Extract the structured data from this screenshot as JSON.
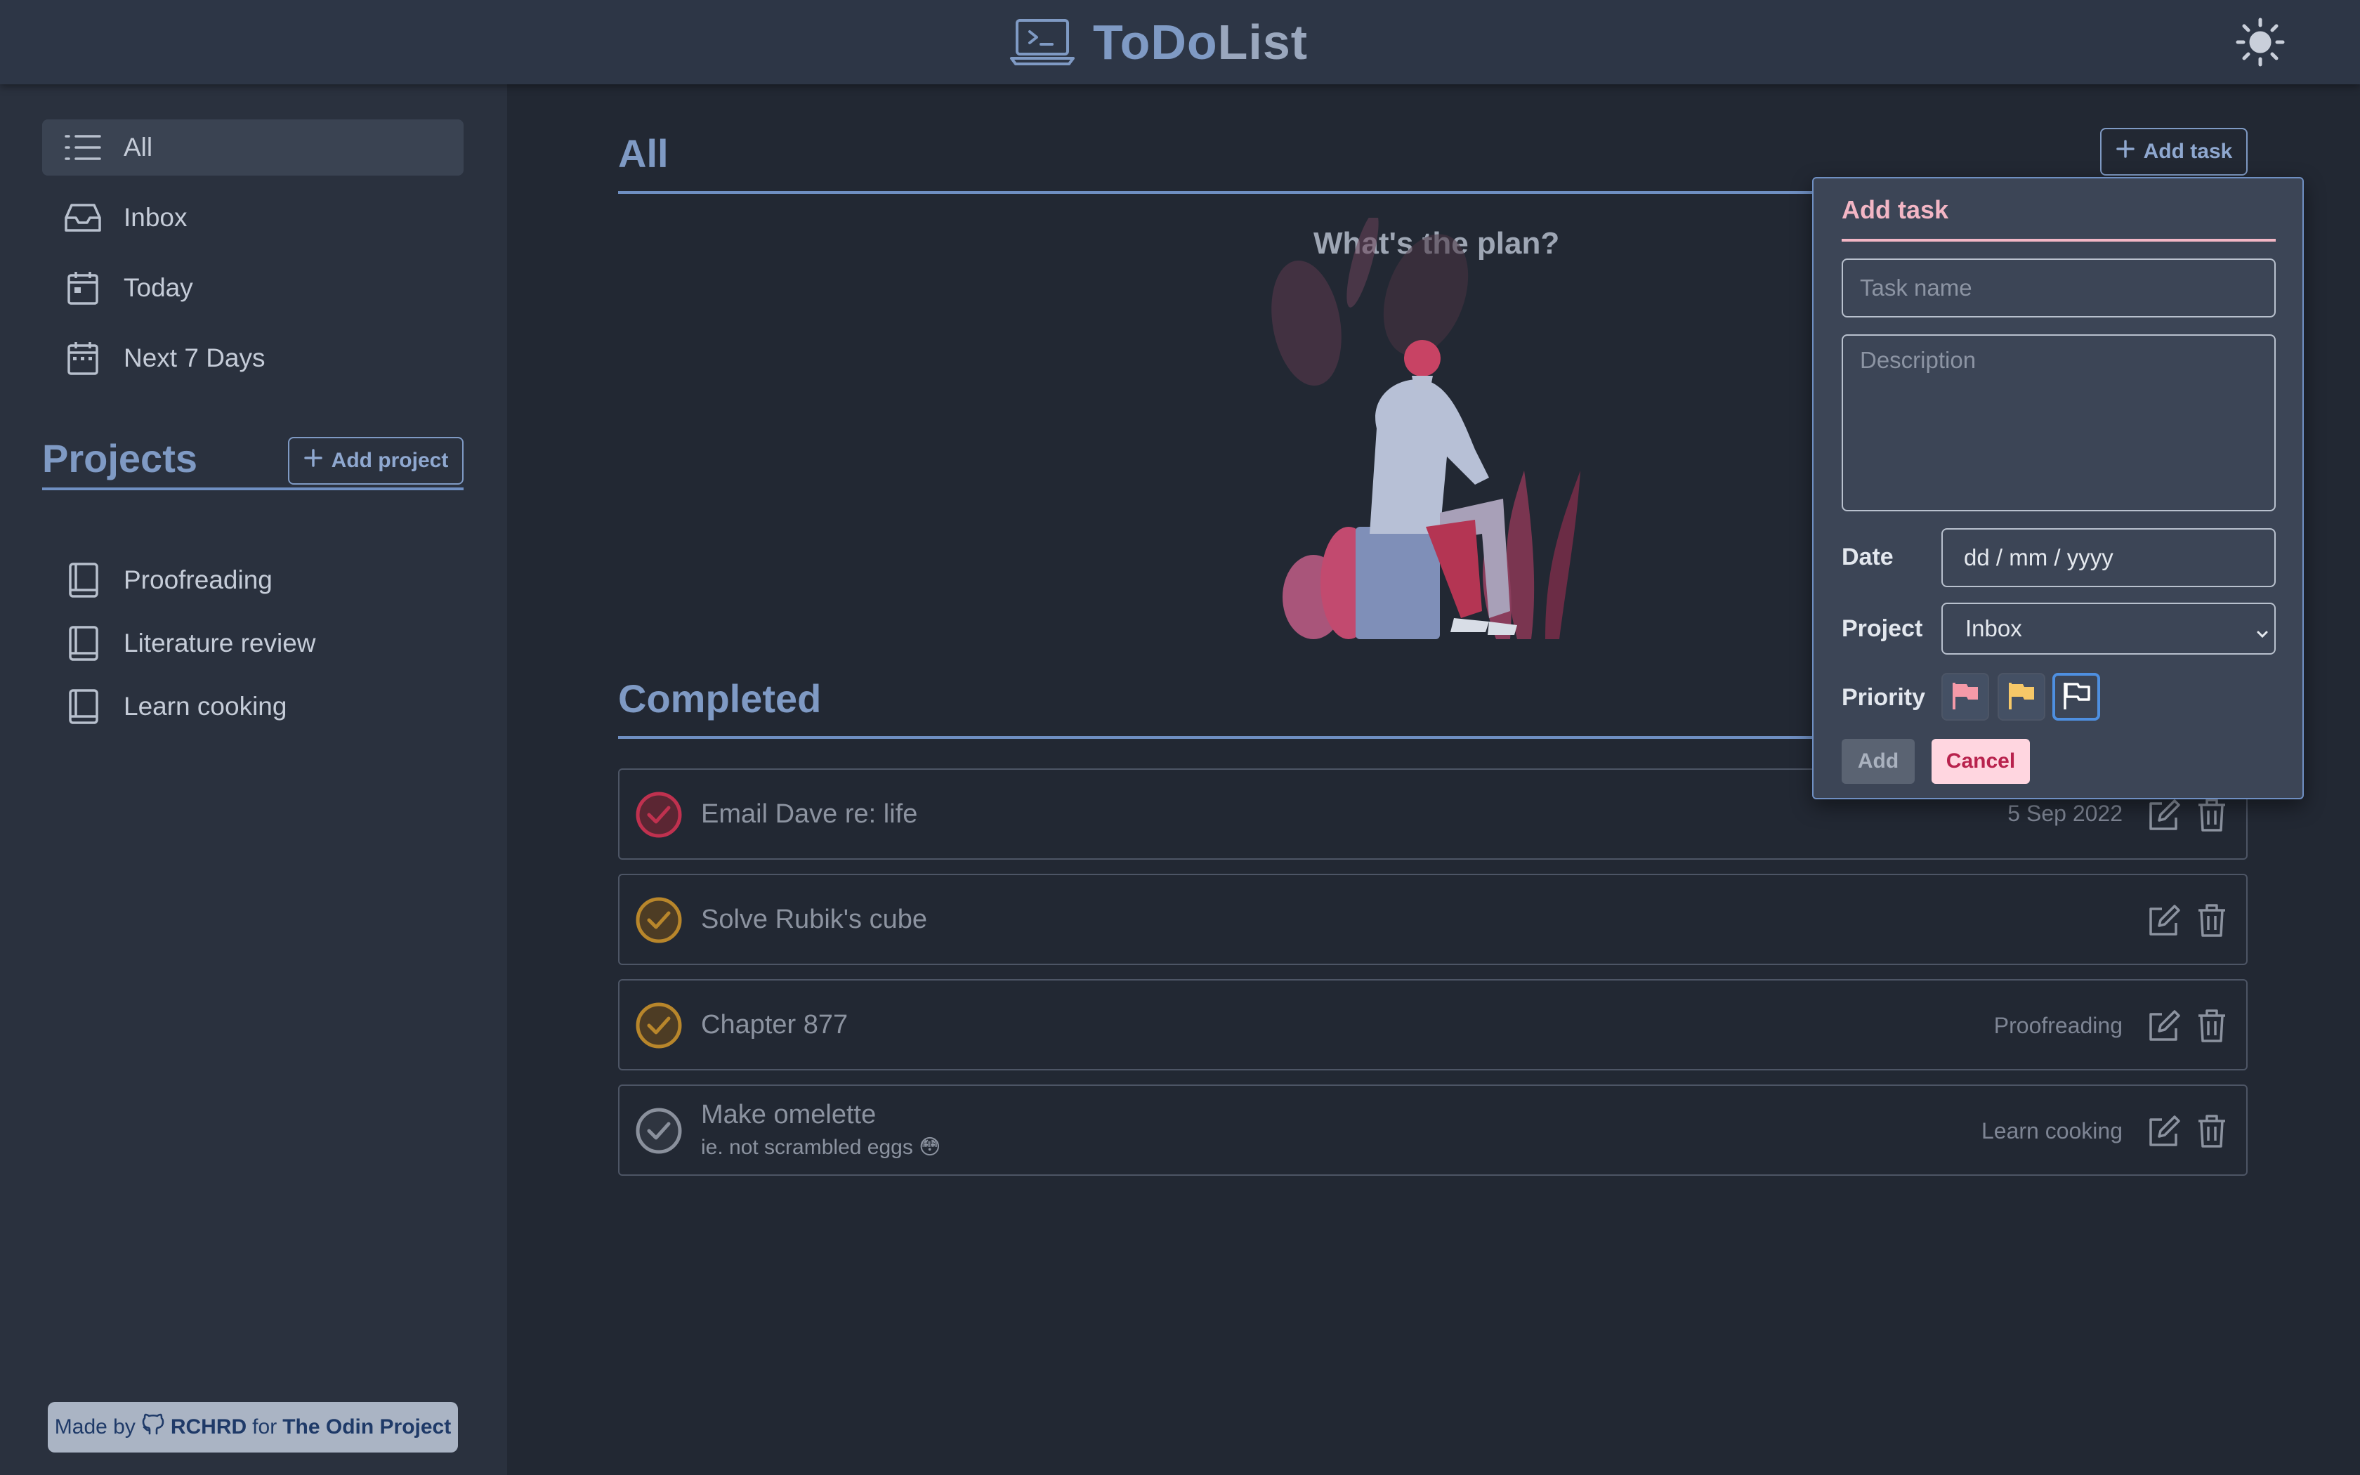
{
  "header": {
    "title_part1": "ToDo",
    "title_part2": "List",
    "logo_icon": "terminal-laptop-icon",
    "theme_icon": "sun-icon"
  },
  "sidebar": {
    "nav": [
      {
        "label": "All",
        "icon": "list-icon"
      },
      {
        "label": "Inbox",
        "icon": "inbox-icon"
      },
      {
        "label": "Today",
        "icon": "calendar-day-icon"
      },
      {
        "label": "Next 7 Days",
        "icon": "calendar-week-icon"
      }
    ],
    "projects_title": "Projects",
    "add_project_label": "Add project",
    "projects": [
      {
        "label": "Proofreading",
        "icon": "book-icon"
      },
      {
        "label": "Literature review",
        "icon": "book-icon"
      },
      {
        "label": "Learn cooking",
        "icon": "book-icon"
      }
    ],
    "footer": {
      "made_by": "Made by",
      "author": "RCHRD",
      "for": "for",
      "org": "The Odin Project"
    }
  },
  "main": {
    "title": "All",
    "add_task_label": "Add task",
    "empty_text": "What's the plan?",
    "completed_title": "Completed",
    "tasks": [
      {
        "name": "Email Dave re: life",
        "desc": "",
        "meta": "5 Sep 2022",
        "priority_color": "#c0314f"
      },
      {
        "name": "Solve Rubik's cube",
        "desc": "",
        "meta": "",
        "priority_color": "#b8862b"
      },
      {
        "name": "Chapter 877",
        "desc": "",
        "meta": "Proofreading",
        "priority_color": "#b8862b"
      },
      {
        "name": "Make omelette",
        "desc": "ie. not scrambled eggs 😳",
        "meta": "Learn cooking",
        "priority_color": "#8a909c"
      }
    ]
  },
  "popup": {
    "title": "Add task",
    "task_name_placeholder": "Task name",
    "description_placeholder": "Description",
    "date_label": "Date",
    "date_value": "dd / mm / yyyy",
    "project_label": "Project",
    "project_value": "Inbox",
    "priority_label": "Priority",
    "add_label": "Add",
    "cancel_label": "Cancel"
  },
  "colors": {
    "accent": "#7f9ac4",
    "popup_accent": "#f3b6c5",
    "high_priority": "#f59aa8",
    "medium_priority": "#f6c868",
    "low_priority": "#ffffff"
  }
}
